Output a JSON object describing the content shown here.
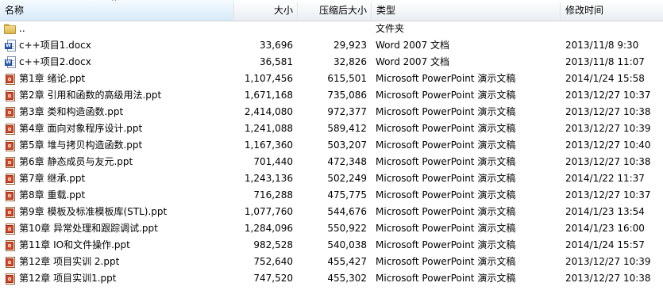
{
  "columns": {
    "name": "名称",
    "size": "大小",
    "compressed": "压缩后大小",
    "type": "类型",
    "modified": "修改时间"
  },
  "sort": {
    "column": "name",
    "arrow": "^"
  },
  "rows": [
    {
      "icon": "folder-up-icon",
      "name": "..",
      "size": "",
      "compressed": "",
      "type": "文件夹",
      "modified": ""
    },
    {
      "icon": "word-document-icon",
      "name": "c++项目1.docx",
      "size": "33,696",
      "compressed": "29,923",
      "type": "Word 2007 文档",
      "modified": "2013/11/8 9:30"
    },
    {
      "icon": "word-document-icon",
      "name": "c++项目2.docx",
      "size": "36,581",
      "compressed": "32,826",
      "type": "Word 2007 文档",
      "modified": "2013/11/8 11:07"
    },
    {
      "icon": "powerpoint-file-icon",
      "name": "第1章 绪论.ppt",
      "size": "1,107,456",
      "compressed": "615,501",
      "type": "Microsoft PowerPoint 演示文稿",
      "modified": "2014/1/24 15:58"
    },
    {
      "icon": "powerpoint-file-icon",
      "name": "第2章 引用和函数的高级用法.ppt",
      "size": "1,671,168",
      "compressed": "735,086",
      "type": "Microsoft PowerPoint 演示文稿",
      "modified": "2013/12/27 10:37"
    },
    {
      "icon": "powerpoint-file-icon",
      "name": "第3章 类和构造函数.ppt",
      "size": "2,414,080",
      "compressed": "972,377",
      "type": "Microsoft PowerPoint 演示文稿",
      "modified": "2013/12/27 10:38"
    },
    {
      "icon": "powerpoint-file-icon",
      "name": "第4章 面向对象程序设计.ppt",
      "size": "1,241,088",
      "compressed": "589,412",
      "type": "Microsoft PowerPoint 演示文稿",
      "modified": "2013/12/27 10:39"
    },
    {
      "icon": "powerpoint-file-icon",
      "name": "第5章 堆与拷贝构造函数.ppt",
      "size": "1,167,360",
      "compressed": "503,207",
      "type": "Microsoft PowerPoint 演示文稿",
      "modified": "2013/12/27 10:40"
    },
    {
      "icon": "powerpoint-file-icon",
      "name": "第6章 静态成员与友元.ppt",
      "size": "701,440",
      "compressed": "472,348",
      "type": "Microsoft PowerPoint 演示文稿",
      "modified": "2013/12/27 10:38"
    },
    {
      "icon": "powerpoint-file-icon",
      "name": "第7章 继承.ppt",
      "size": "1,243,136",
      "compressed": "502,249",
      "type": "Microsoft PowerPoint 演示文稿",
      "modified": "2014/1/22 11:37"
    },
    {
      "icon": "powerpoint-file-icon",
      "name": "第8章 重载.ppt",
      "size": "716,288",
      "compressed": "475,775",
      "type": "Microsoft PowerPoint 演示文稿",
      "modified": "2013/12/27 10:37"
    },
    {
      "icon": "powerpoint-file-icon",
      "name": "第9章 模板及标准模板库(STL).ppt",
      "size": "1,077,760",
      "compressed": "544,676",
      "type": "Microsoft PowerPoint 演示文稿",
      "modified": "2014/1/23 13:54"
    },
    {
      "icon": "powerpoint-file-icon",
      "name": "第10章 异常处理和跟踪调试.ppt",
      "size": "1,284,096",
      "compressed": "550,922",
      "type": "Microsoft PowerPoint 演示文稿",
      "modified": "2014/1/23 16:00"
    },
    {
      "icon": "powerpoint-file-icon",
      "name": "第11章 IO和文件操作.ppt",
      "size": "982,528",
      "compressed": "540,038",
      "type": "Microsoft PowerPoint 演示文稿",
      "modified": "2014/1/24 15:57"
    },
    {
      "icon": "powerpoint-file-icon",
      "name": "第12章 项目实训 2.ppt",
      "size": "752,640",
      "compressed": "455,427",
      "type": "Microsoft PowerPoint 演示文稿",
      "modified": "2013/12/27 10:39"
    },
    {
      "icon": "powerpoint-file-icon",
      "name": "第12章 项目实训1.ppt",
      "size": "747,520",
      "compressed": "455,302",
      "type": "Microsoft PowerPoint 演示文稿",
      "modified": "2013/12/27 10:38"
    }
  ]
}
